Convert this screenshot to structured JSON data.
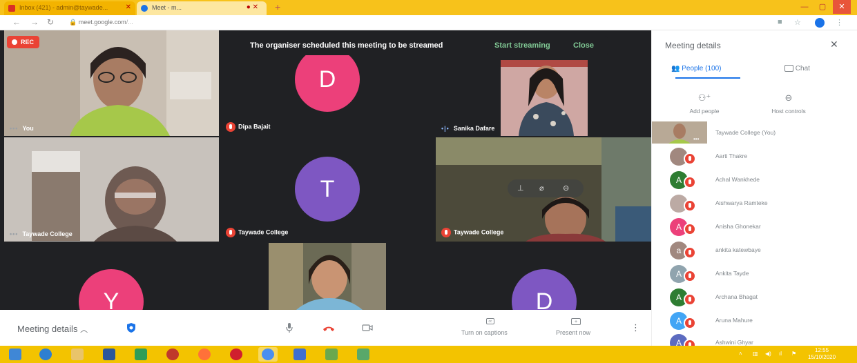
{
  "browser": {
    "tabs": [
      {
        "label": "Inbox (421) - admin@taywade...",
        "favicon_color": "#d93025",
        "active": false
      },
      {
        "label": "Meet - m...",
        "favicon_color": "#1a73e8",
        "active": true
      }
    ],
    "new_tab": "+",
    "address": {
      "domain": "meet.google.com",
      "path": "/..."
    },
    "window_controls": {
      "minimize": "—",
      "maximize": "▢",
      "close": "✕"
    }
  },
  "meet": {
    "rec_badge": "REC",
    "banner": {
      "message": "The organiser scheduled this meeting to be streamed",
      "start_label": "Start streaming",
      "close_label": "Close"
    },
    "tiles": [
      {
        "id": "you",
        "name": "You",
        "type": "video",
        "indicator": "dots"
      },
      {
        "id": "dipa",
        "name": "Dipa Bajait",
        "type": "avatar",
        "letter": "D",
        "color": "#ec407a",
        "indicator": "muted"
      },
      {
        "id": "sanika",
        "name": "Sanika Dafare",
        "type": "video",
        "indicator": "speaking"
      },
      {
        "id": "tc1",
        "name": "Taywade College",
        "type": "video",
        "indicator": "dots"
      },
      {
        "id": "tc2",
        "name": "Taywade College",
        "type": "avatar",
        "letter": "T",
        "color": "#7e57c2",
        "indicator": "muted"
      },
      {
        "id": "tc3",
        "name": "Taywade College",
        "type": "video",
        "indicator": "muted"
      },
      {
        "id": "y",
        "name": "",
        "type": "avatar",
        "letter": "Y",
        "color": "#ec407a"
      },
      {
        "id": "student",
        "name": "",
        "type": "video"
      },
      {
        "id": "d2",
        "name": "",
        "type": "avatar",
        "letter": "D",
        "color": "#7e57c2"
      }
    ],
    "controls": {
      "meeting_details": "Meeting details",
      "captions_label": "Turn on captions",
      "present_label": "Present now"
    }
  },
  "panel": {
    "title": "Meeting details",
    "tabs": {
      "people": "People (100)",
      "chat": "Chat"
    },
    "actions": {
      "add_people": "Add people",
      "host_controls": "Host controls"
    },
    "people": [
      {
        "name": "Taywade College (You)",
        "letter": "",
        "color": "#8d6e63",
        "photo": true,
        "muted": false
      },
      {
        "name": "Aarti Thakre",
        "letter": "",
        "color": "#a1887f",
        "photo": true,
        "muted": true
      },
      {
        "name": "Achal Wankhede",
        "letter": "A",
        "color": "#2e7d32",
        "photo": false,
        "muted": true
      },
      {
        "name": "Aishwarya Ramteke",
        "letter": "",
        "color": "#bcaaa4",
        "photo": true,
        "muted": true
      },
      {
        "name": "Anisha Ghonekar",
        "letter": "A",
        "color": "#ec407a",
        "photo": false,
        "muted": true
      },
      {
        "name": "ankita katewbaye",
        "letter": "a",
        "color": "#a1887f",
        "photo": false,
        "muted": true
      },
      {
        "name": "Ankita Tayde",
        "letter": "A",
        "color": "#90a4ae",
        "photo": false,
        "muted": true
      },
      {
        "name": "Archana Bhagat",
        "letter": "A",
        "color": "#2e7d32",
        "photo": false,
        "muted": true
      },
      {
        "name": "Aruna Mahure",
        "letter": "A",
        "color": "#42a5f5",
        "photo": false,
        "muted": true
      },
      {
        "name": "Ashwini Ghyar",
        "letter": "A",
        "color": "#5c6bc0",
        "photo": false,
        "muted": true
      }
    ]
  },
  "taskbar": {
    "apps": [
      {
        "name": "start",
        "color": "#3f87d6"
      },
      {
        "name": "internet-explorer",
        "color": "#2f7fd1"
      },
      {
        "name": "file-explorer",
        "color": "#e9c46a"
      },
      {
        "name": "word",
        "color": "#2b579a"
      },
      {
        "name": "green-app",
        "color": "#2e9d57"
      },
      {
        "name": "red-app",
        "color": "#c0392b"
      },
      {
        "name": "firefox",
        "color": "#ff7139"
      },
      {
        "name": "opera",
        "color": "#d01f2e"
      },
      {
        "name": "chrome",
        "color": "#4a8ff0"
      },
      {
        "name": "blue-app",
        "color": "#3f6fd1"
      },
      {
        "name": "photos",
        "color": "#6aa84f"
      },
      {
        "name": "excel",
        "color": "#58a86a"
      }
    ],
    "time": "12:55",
    "date": "15/10/2020"
  }
}
